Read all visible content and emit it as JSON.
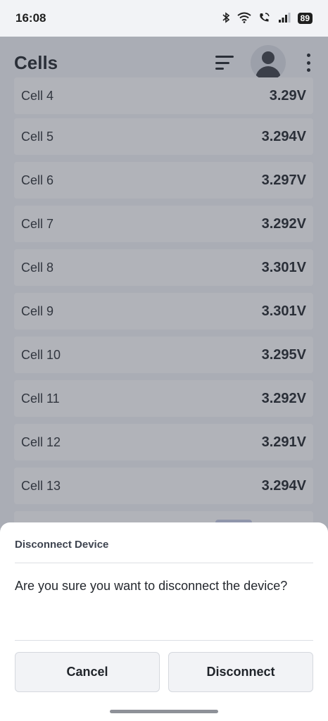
{
  "status_bar": {
    "time": "16:08",
    "battery": "89",
    "icons": [
      "bluetooth-icon",
      "wifi-icon",
      "wifi-calling-icon",
      "signal-icon",
      "battery-icon"
    ]
  },
  "app_bar": {
    "title": "Cells",
    "icons": [
      "sort-icon",
      "avatar",
      "more-vert-icon"
    ]
  },
  "cells": [
    {
      "name": "Cell 4",
      "voltage": "3.29V"
    },
    {
      "name": "Cell 5",
      "voltage": "3.294V"
    },
    {
      "name": "Cell 6",
      "voltage": "3.297V"
    },
    {
      "name": "Cell 7",
      "voltage": "3.292V"
    },
    {
      "name": "Cell 8",
      "voltage": "3.301V"
    },
    {
      "name": "Cell 9",
      "voltage": "3.301V"
    },
    {
      "name": "Cell 10",
      "voltage": "3.295V"
    },
    {
      "name": "Cell 11",
      "voltage": "3.292V"
    },
    {
      "name": "Cell 12",
      "voltage": "3.291V"
    },
    {
      "name": "Cell 13",
      "voltage": "3.294V"
    }
  ],
  "dialog": {
    "title": "Disconnect Device",
    "message": "Are you sure you want to disconnect the device?",
    "cancel_label": "Cancel",
    "confirm_label": "Disconnect"
  },
  "colors": {
    "scrim": "#3c4050",
    "button_bg": "#f2f3f6",
    "text_primary": "#1f2329"
  }
}
